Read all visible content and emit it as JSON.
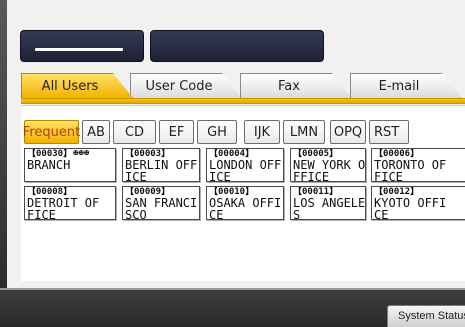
{
  "header": {
    "left_box_text": "",
    "right_box_text": ""
  },
  "tabs": [
    {
      "label": "All Users",
      "active": true
    },
    {
      "label": "User Code",
      "active": false
    },
    {
      "label": "Fax",
      "active": false
    },
    {
      "label": "E-mail",
      "active": false
    }
  ],
  "filter_tabs": [
    {
      "label": "Frequent",
      "active": true
    },
    {
      "label": "AB"
    },
    {
      "label": "CD"
    },
    {
      "label": "EF"
    },
    {
      "label": "GH"
    },
    {
      "label": "IJK"
    },
    {
      "label": "LMN"
    },
    {
      "label": "OPQ"
    },
    {
      "label": "RST"
    }
  ],
  "entries": [
    {
      "number": "【00030】",
      "name": "BRANCH",
      "group": true
    },
    {
      "number": "【00003】",
      "name": "BERLIN OFFICE"
    },
    {
      "number": "【00004】",
      "name": "LONDON OFFICE"
    },
    {
      "number": "【00005】",
      "name": "NEW YORK OFFICE"
    },
    {
      "number": "【00006】",
      "name": "TORONTO OFFICE"
    },
    {
      "number": "【00008】",
      "name": "DETROIT OFFICE"
    },
    {
      "number": "【00009】",
      "name": "SAN FRANCISCO"
    },
    {
      "number": "【00010】",
      "name": "OSAKA OFFICE"
    },
    {
      "number": "【00011】",
      "name": "LOS ANGELES"
    },
    {
      "number": "【00012】",
      "name": "KYOTO OFFICE"
    }
  ],
  "icons": {
    "group": "group-icon"
  },
  "status": {
    "button_label": "System Status"
  },
  "colors": {
    "active_tab": "#f2b300",
    "top_box": "#22273d",
    "status_bar": "#333333"
  }
}
